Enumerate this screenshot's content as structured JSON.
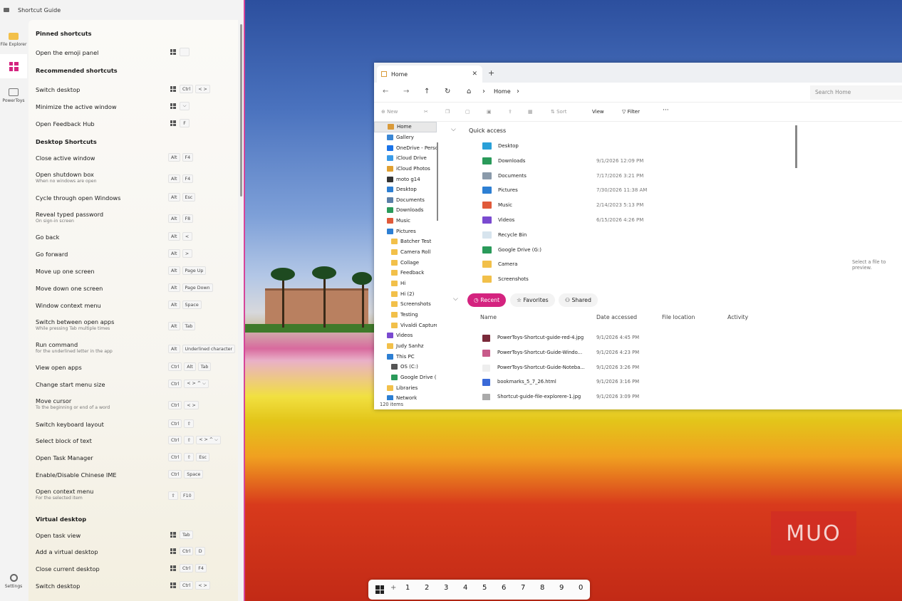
{
  "window_title": "Shortcut Guide",
  "rail": {
    "file_explorer": "File Explorer",
    "powertoys": "PowerToys",
    "settings": "Settings"
  },
  "sections": {
    "pinned": "Pinned shortcuts",
    "recommended": "Recommended shortcuts",
    "desktop": "Desktop Shortcuts",
    "virtual": "Virtual desktop"
  },
  "shortcuts": [
    {
      "name": "Open the emoji panel",
      "keys": [
        "WIN",
        ""
      ]
    },
    {
      "name": "Switch desktop",
      "keys": [
        "WIN",
        "Ctrl",
        "< >"
      ]
    },
    {
      "name": "Minimize the active window",
      "keys": [
        "WIN",
        "⌵"
      ]
    },
    {
      "name": "Open Feedback Hub",
      "keys": [
        "WIN",
        "F"
      ]
    },
    {
      "name": "Close active window",
      "keys": [
        "Alt",
        "F4"
      ]
    },
    {
      "name": "Open shutdown box",
      "sub": "When no windows are open",
      "keys": [
        "Alt",
        "F4"
      ]
    },
    {
      "name": "Cycle through open Windows",
      "keys": [
        "Alt",
        "Esc"
      ]
    },
    {
      "name": "Reveal typed password",
      "sub": "On sign-in screen",
      "keys": [
        "Alt",
        "F8"
      ]
    },
    {
      "name": "Go back",
      "keys": [
        "Alt",
        "<"
      ]
    },
    {
      "name": "Go forward",
      "keys": [
        "Alt",
        ">"
      ]
    },
    {
      "name": "Move up one screen",
      "keys": [
        "Alt",
        "Page Up"
      ]
    },
    {
      "name": "Move down one screen",
      "keys": [
        "Alt",
        "Page Down"
      ]
    },
    {
      "name": "Window context menu",
      "keys": [
        "Alt",
        "Space"
      ]
    },
    {
      "name": "Switch between open apps",
      "sub": "While pressing Tab multiple times",
      "keys": [
        "Alt",
        "Tab"
      ]
    },
    {
      "name": "Run command",
      "sub": "for the underlined letter in the app",
      "keys": [
        "Alt",
        "Underlined character"
      ]
    },
    {
      "name": "View open apps",
      "keys": [
        "Ctrl",
        "Alt",
        "Tab"
      ]
    },
    {
      "name": "Change start menu size",
      "keys": [
        "Ctrl",
        "< > ^ ⌵"
      ]
    },
    {
      "name": "Move cursor",
      "sub": "To the beginning or end of a word",
      "keys": [
        "Ctrl",
        "< >"
      ]
    },
    {
      "name": "Switch keyboard layout",
      "keys": [
        "Ctrl",
        "⇧"
      ]
    },
    {
      "name": "Select block of text",
      "keys": [
        "Ctrl",
        "⇧",
        "< > ^ ⌵"
      ]
    },
    {
      "name": "Open Task Manager",
      "keys": [
        "Ctrl",
        "⇧",
        "Esc"
      ]
    },
    {
      "name": "Enable/Disable Chinese IME",
      "keys": [
        "Ctrl",
        "Space"
      ]
    },
    {
      "name": "Open context menu",
      "sub": "For the selected item",
      "keys": [
        "⇧",
        "F10"
      ]
    },
    {
      "name": "Open task view",
      "keys": [
        "WIN",
        "Tab"
      ]
    },
    {
      "name": "Add a virtual desktop",
      "keys": [
        "WIN",
        "Ctrl",
        "D"
      ]
    },
    {
      "name": "Close current desktop",
      "keys": [
        "WIN",
        "Ctrl",
        "F4"
      ]
    },
    {
      "name": "Switch desktop",
      "keys": [
        "WIN",
        "Ctrl",
        "< >"
      ]
    }
  ],
  "explorer": {
    "tab": "Home",
    "close": "✕",
    "plus": "+",
    "breadcrumb": "Home",
    "search_placeholder": "Search Home",
    "cmd": {
      "new": "New",
      "sort": "Sort",
      "view": "View",
      "filter": "Filter",
      "more": "···"
    },
    "nav": [
      {
        "label": "Home",
        "color": "#d99a3a"
      },
      {
        "label": "Gallery",
        "color": "#3a86d4"
      },
      {
        "label": "OneDrive - Personal",
        "color": "#1a73e8"
      },
      {
        "label": "iCloud Drive",
        "color": "#3a9be8"
      },
      {
        "label": "iCloud Photos",
        "color": "#e0a030"
      },
      {
        "label": "moto g14",
        "color": "#333333"
      },
      {
        "label": "Desktop",
        "color": "#2d7fd3"
      },
      {
        "label": "Documents",
        "color": "#5a7fa8"
      },
      {
        "label": "Downloads",
        "color": "#2a9a5a"
      },
      {
        "label": "Music",
        "color": "#e05a3a"
      },
      {
        "label": "Pictures",
        "color": "#2d7fd3"
      },
      {
        "label": "Batcher Test",
        "color": "#f2c04a"
      },
      {
        "label": "Camera Roll",
        "color": "#f2c04a"
      },
      {
        "label": "Collage",
        "color": "#f2c04a"
      },
      {
        "label": "Feedback",
        "color": "#f2c04a"
      },
      {
        "label": "Hi",
        "color": "#f2c04a"
      },
      {
        "label": "Hi (2)",
        "color": "#f2c04a"
      },
      {
        "label": "Screenshots",
        "color": "#f2c04a"
      },
      {
        "label": "Testing",
        "color": "#f2c04a"
      },
      {
        "label": "Vivaldi Captures",
        "color": "#f2c04a"
      },
      {
        "label": "Videos",
        "color": "#7a4ad0"
      },
      {
        "label": "Judy Sanhz",
        "color": "#f2c04a"
      },
      {
        "label": "This PC",
        "color": "#2d7fd3"
      },
      {
        "label": "OS (C:)",
        "color": "#555555"
      },
      {
        "label": "Google Drive (G:)",
        "color": "#2a9a5a"
      },
      {
        "label": "Libraries",
        "color": "#f2c04a"
      },
      {
        "label": "Network",
        "color": "#2d7fd3"
      }
    ],
    "quick_access_title": "Quick access",
    "quick_access": [
      {
        "name": "Desktop",
        "date": "",
        "color": "#2aa0d8"
      },
      {
        "name": "Downloads",
        "date": "9/1/2026 12:09 PM",
        "color": "#2a9a5a"
      },
      {
        "name": "Documents",
        "date": "7/17/2026 3:21 PM",
        "color": "#8a9aaa"
      },
      {
        "name": "Pictures",
        "date": "7/30/2026 11:38 AM",
        "color": "#2d7fd3"
      },
      {
        "name": "Music",
        "date": "2/14/2023 5:13 PM",
        "color": "#e05a3a"
      },
      {
        "name": "Videos",
        "date": "6/15/2026 4:26 PM",
        "color": "#7a4ad0"
      },
      {
        "name": "Recycle Bin",
        "date": "",
        "color": "#d7e4ee"
      },
      {
        "name": "Google Drive (G:)",
        "date": "",
        "color": "#2a9a5a"
      },
      {
        "name": "Camera",
        "date": "",
        "color": "#f2c04a"
      },
      {
        "name": "Screenshots",
        "date": "",
        "color": "#f2c04a"
      }
    ],
    "pills": {
      "recent": "Recent",
      "favorites": "Favorites",
      "shared": "Shared"
    },
    "recent_headers": {
      "name": "Name",
      "date": "Date accessed",
      "location": "File location",
      "activity": "Activity"
    },
    "recent": [
      {
        "name": "PowerToys-Shortcut-guide-red-4.jpg",
        "date": "9/1/2026 4:45 PM",
        "color": "#7a2a3a"
      },
      {
        "name": "PowerToys-Shortcut-Guide-Windo...",
        "date": "9/1/2026 4:23 PM",
        "color": "#c85a8a"
      },
      {
        "name": "PowerToys-Shortcut-Guide-Noteba...",
        "date": "9/1/2026 3:26 PM",
        "color": "#eeeeee"
      },
      {
        "name": "bookmarks_5_7_26.html",
        "date": "9/1/2026 3:16 PM",
        "color": "#3a6ad8"
      },
      {
        "name": "Shortcut-guide-file-explorere-1.jpg",
        "date": "9/1/2026 3:09 PM",
        "color": "#aaaaaa"
      }
    ],
    "preview_hint": "Select a file to preview.",
    "status": "120 items"
  },
  "taskbar": {
    "plus": "+",
    "digits": [
      "1",
      "2",
      "3",
      "4",
      "5",
      "6",
      "7",
      "8",
      "9",
      "0"
    ]
  },
  "watermark": "MUO"
}
